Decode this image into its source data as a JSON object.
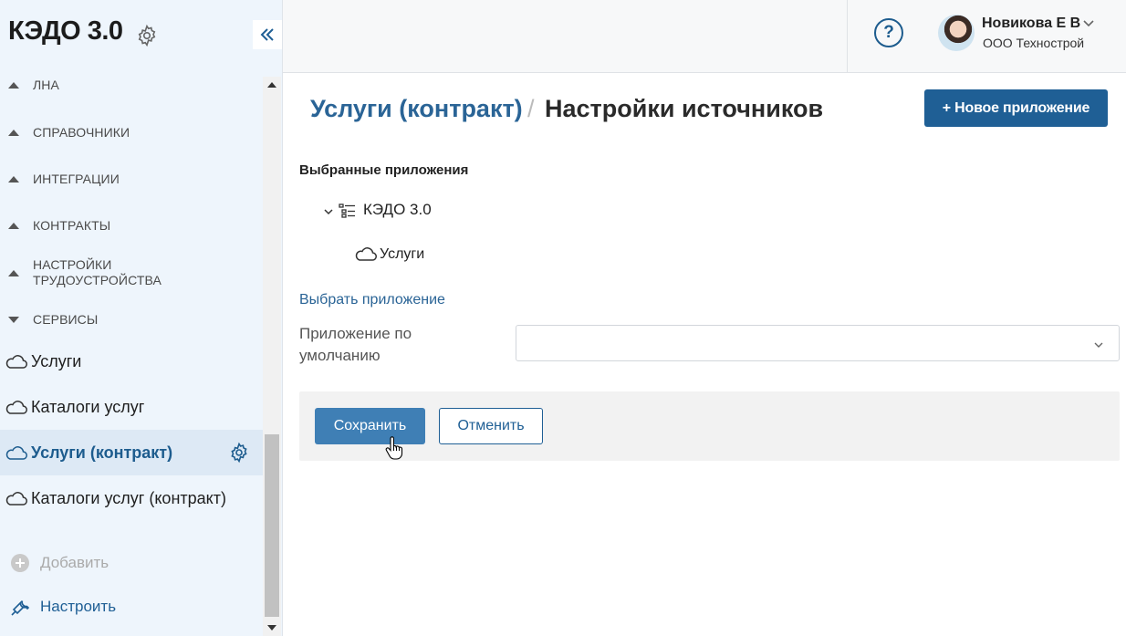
{
  "sidebar": {
    "brand": "КЭДО 3.0",
    "sections": [
      {
        "label": "ЛНА",
        "expanded": false
      },
      {
        "label": "СПРАВОЧНИКИ",
        "expanded": false
      },
      {
        "label": "ИНТЕГРАЦИИ",
        "expanded": false
      },
      {
        "label": "КОНТРАКТЫ",
        "expanded": false
      },
      {
        "label": "НАСТРОЙКИ ТРУДОУСТРОЙСТВА",
        "expanded": false
      },
      {
        "label": "СЕРВИСЫ",
        "expanded": true
      }
    ],
    "items": [
      {
        "label": "Услуги",
        "icon": "cloud-icon"
      },
      {
        "label": "Каталоги услуг",
        "icon": "cloud-icon"
      },
      {
        "label": "Услуги (контракт)",
        "icon": "cloud-icon",
        "active": true
      },
      {
        "label": "Каталоги услуг (контракт)",
        "icon": "cloud-icon"
      }
    ],
    "add_label": "Добавить",
    "configure_label": "Настроить"
  },
  "topbar": {
    "user_name": "Новикова Е В",
    "company": "ООО Технострой",
    "help_glyph": "?"
  },
  "main": {
    "breadcrumb_parent": "Услуги (контракт)",
    "breadcrumb_sep": "/",
    "title": "Настройки источников",
    "new_app_button": "+ Новое приложение",
    "selected_apps_label": "Выбранные приложения",
    "tree": {
      "app": "КЭДО 3.0",
      "child": "Услуги"
    },
    "choose_app_link": "Выбрать приложение",
    "default_app_label": "Приложение по умолчанию",
    "default_app_value": "",
    "save_button": "Сохранить",
    "cancel_button": "Отменить"
  },
  "colors": {
    "accent": "#1f5f95",
    "link": "#2a6496",
    "sidebar_bg": "#eef5fc",
    "active_bg": "#dde9f5"
  }
}
